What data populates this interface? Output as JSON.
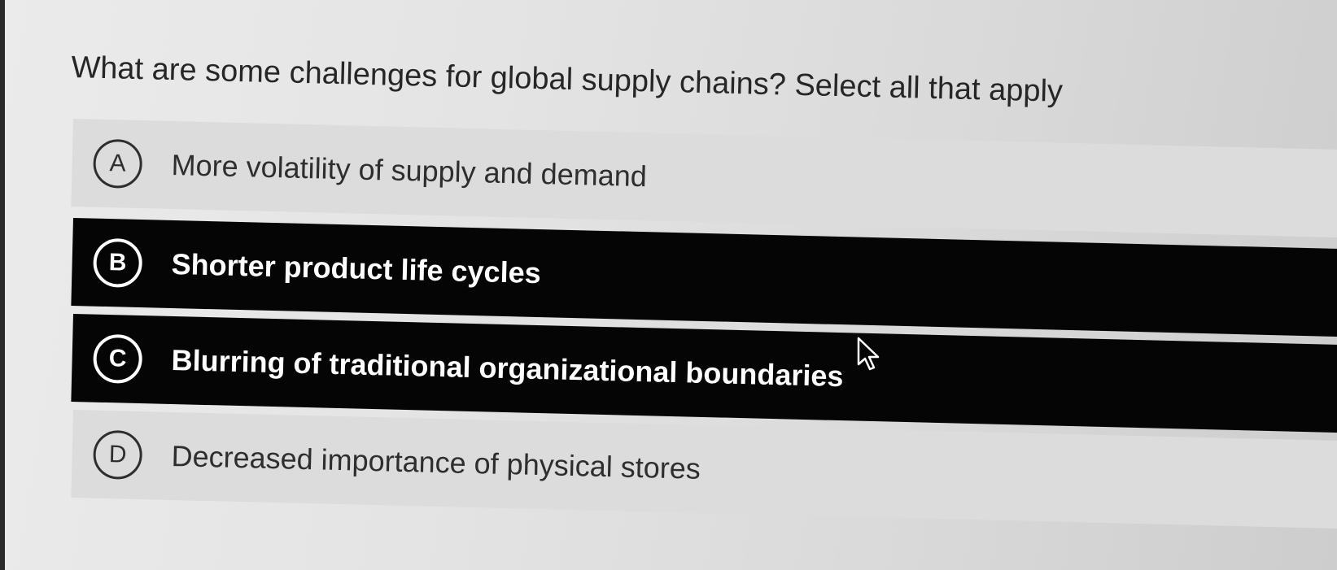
{
  "question": {
    "text": "What are some challenges for global supply chains? Select all that apply"
  },
  "options": [
    {
      "letter": "A",
      "text": "More volatility of supply and demand",
      "selected": false
    },
    {
      "letter": "B",
      "text": "Shorter product life cycles",
      "selected": true
    },
    {
      "letter": "C",
      "text": "Blurring of traditional organizational boundaries",
      "selected": true
    },
    {
      "letter": "D",
      "text": "Decreased importance of physical stores",
      "selected": false
    }
  ],
  "colors": {
    "selected_bg": "#050505",
    "selected_fg": "#ffffff",
    "unselected_bg": "#dcdcdc",
    "unselected_fg": "#2e2e2e"
  },
  "icons": {
    "cursor": "mouse-pointer-icon"
  }
}
